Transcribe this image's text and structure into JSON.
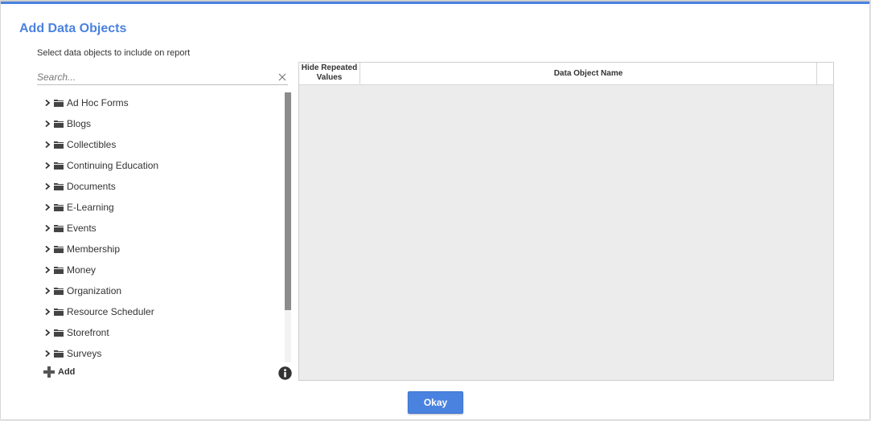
{
  "dialog": {
    "title": "Add Data Objects",
    "subtitle": "Select data objects to include on report"
  },
  "search": {
    "placeholder": "Search...",
    "value": ""
  },
  "tree": {
    "items": [
      {
        "label": "Ad Hoc Forms"
      },
      {
        "label": "Blogs"
      },
      {
        "label": "Collectibles"
      },
      {
        "label": "Continuing Education"
      },
      {
        "label": "Documents"
      },
      {
        "label": "E-Learning"
      },
      {
        "label": "Events"
      },
      {
        "label": "Membership"
      },
      {
        "label": "Money"
      },
      {
        "label": "Organization"
      },
      {
        "label": "Resource Scheduler"
      },
      {
        "label": "Storefront"
      },
      {
        "label": "Surveys"
      }
    ]
  },
  "footer": {
    "add_label": "Add",
    "okay_label": "Okay"
  },
  "grid": {
    "columns": {
      "hide_line1": "Hide Repeated",
      "hide_line2": "Values",
      "name": "Data Object Name"
    }
  },
  "colors": {
    "accent": "#4a82e0",
    "text": "#333333",
    "grid_bg": "#ececec"
  },
  "icons": {
    "tree_expand": "chevron-right-icon",
    "tree_folder": "folder-icon",
    "clear": "close-icon",
    "add": "plus-icon",
    "info": "info-icon"
  }
}
